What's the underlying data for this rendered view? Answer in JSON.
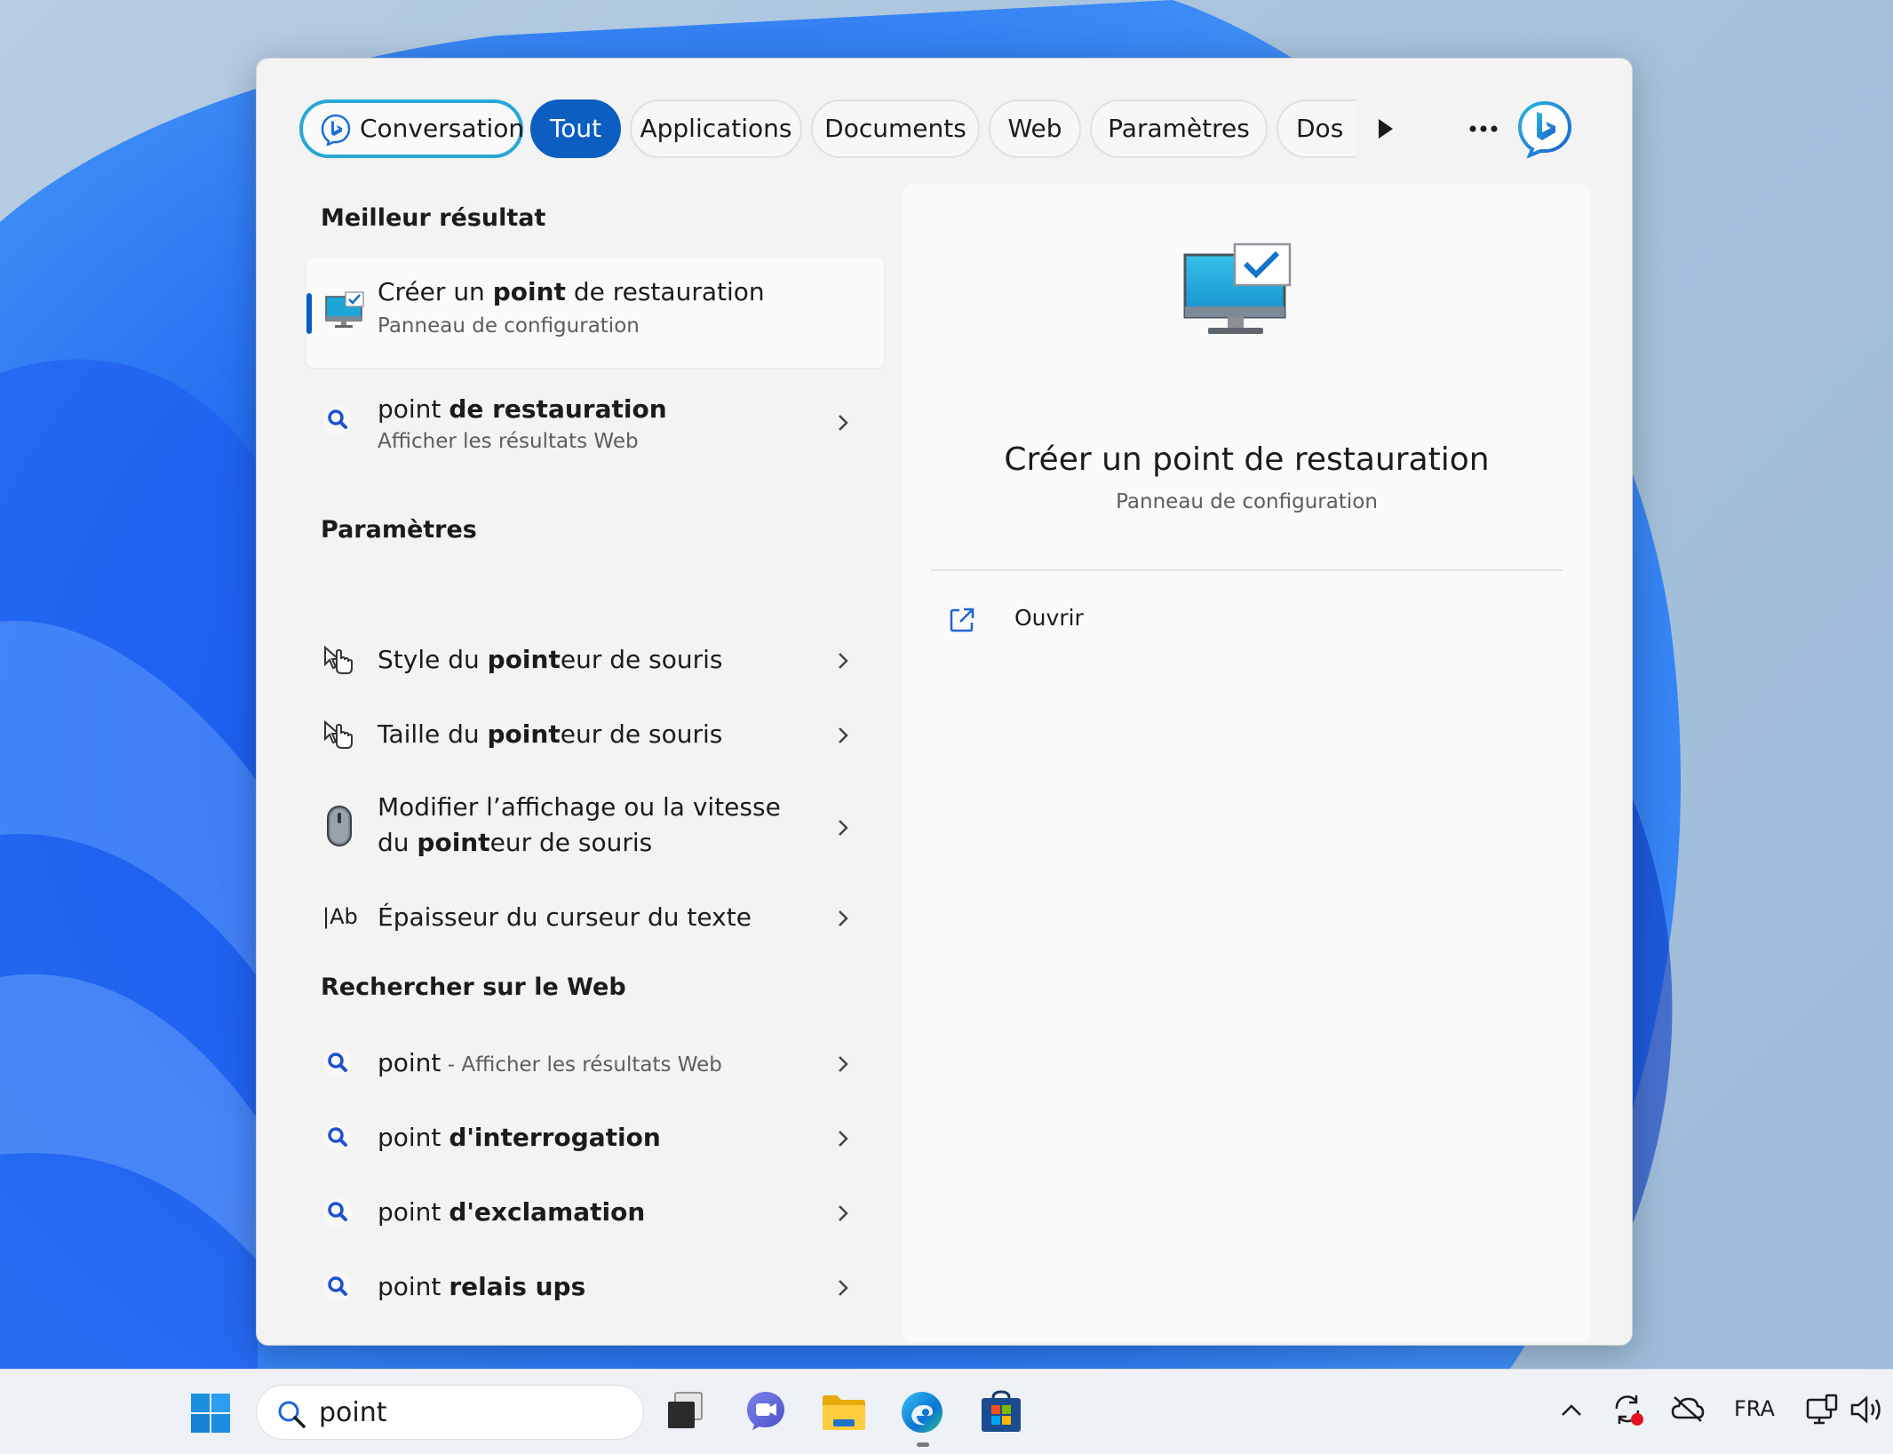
{
  "filters": {
    "conversation": "Conversation",
    "all": "Tout",
    "apps": "Applications",
    "documents": "Documents",
    "web": "Web",
    "settings": "Paramètres",
    "folders": "Dos"
  },
  "sections": {
    "best": "Meilleur résultat",
    "settings": "Paramètres",
    "web": "Rechercher sur le Web"
  },
  "best_result": {
    "title_pre": "Créer un ",
    "title_bold": "point",
    "title_post": " de restauration",
    "subtitle": "Panneau de configuration"
  },
  "web_suggestion": {
    "title_pre": "point ",
    "title_bold": "de restauration",
    "subtitle": "Afficher les résultats Web"
  },
  "settings_items": [
    {
      "pre": "Style du ",
      "bold": "point",
      "post": "eur de souris"
    },
    {
      "pre": "Taille du ",
      "bold": "point",
      "post": "eur de souris"
    },
    {
      "line1": "Modifier l’affichage ou la vitesse",
      "line2_pre": "du ",
      "line2_bold": "point",
      "line2_post": "eur de souris"
    },
    {
      "pre": "Épaisseur du curseur du texte",
      "bold": "",
      "post": ""
    }
  ],
  "web_items": [
    {
      "pre": "point",
      "bold": "",
      "sub": " - Afficher les résultats Web"
    },
    {
      "pre": "point ",
      "bold": "d'interrogation"
    },
    {
      "pre": "point ",
      "bold": "d'exclamation"
    },
    {
      "pre": "point ",
      "bold": "relais ups"
    }
  ],
  "preview": {
    "title": "Créer un point de restauration",
    "subtitle": "Panneau de configuration",
    "action_open": "Ouvrir"
  },
  "taskbar": {
    "search_value": "point",
    "language": "FRA"
  },
  "text_icons": {
    "text_cursor_icon": "|Ab"
  },
  "colors": {
    "accent": "#0c5fc1",
    "bing_teal": "#26a8d6"
  }
}
